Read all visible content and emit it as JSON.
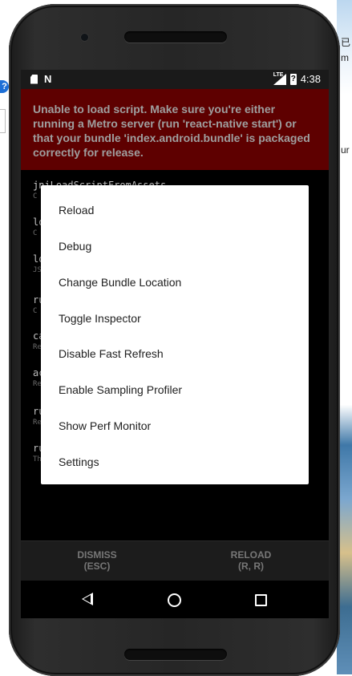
{
  "statusbar": {
    "lte": "LTE",
    "time": "4:38"
  },
  "redbox": {
    "message": "Unable to load script. Make sure you're either running a Metro server (run 'react-native start') or that your bundle 'index.android.bundle' is packaged correctly for release."
  },
  "stack": [
    {
      "fn": "jniLoadScriptFromAssets",
      "file": "C"
    },
    {
      "fn": "lo",
      "file": "C"
    },
    {
      "fn": "lo",
      "file": "JS"
    },
    {
      "fn": "ru",
      "file": "C"
    },
    {
      "fn": "ca",
      "file": "Re"
    },
    {
      "fn": "ac",
      "file": "Re"
    },
    {
      "fn": "ru",
      "file": "Re"
    },
    {
      "fn": "ru",
      "file": "Th"
    }
  ],
  "actions": {
    "dismiss": {
      "label": "DISMISS",
      "shortcut": "(ESC)"
    },
    "reload": {
      "label": "RELOAD",
      "shortcut": "(R, R)"
    }
  },
  "menu": {
    "items": [
      "Reload",
      "Debug",
      "Change Bundle Location",
      "Toggle Inspector",
      "Disable Fast Refresh",
      "Enable Sampling Profiler",
      "Show Perf Monitor",
      "Settings"
    ]
  },
  "background": {
    "help_icon": "?",
    "right_fragments": [
      "已",
      "m",
      "ur"
    ]
  },
  "colors": {
    "redbox_bg": "#5e0000",
    "redbox_text": "#9f9f9f",
    "screen_bg": "#000000",
    "menu_bg": "#ffffff"
  },
  "icons": [
    "sd-card-icon",
    "n-notification-icon",
    "signal-icon",
    "battery-icon",
    "back-icon",
    "home-icon",
    "recents-icon"
  ]
}
